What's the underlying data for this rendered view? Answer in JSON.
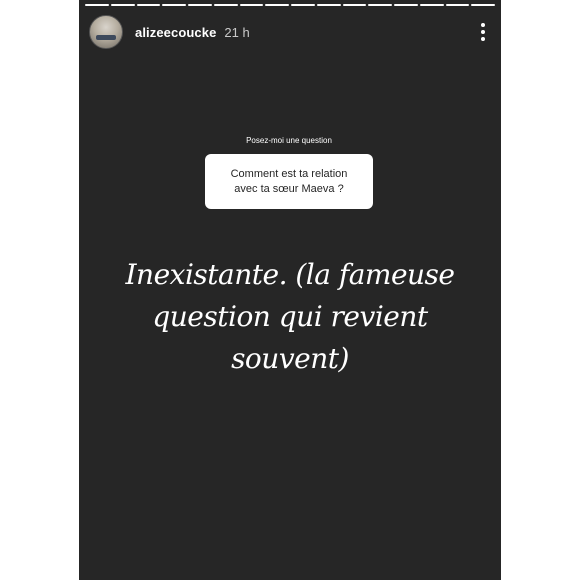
{
  "story": {
    "progress": {
      "segments": 16,
      "completed": 15
    },
    "header": {
      "username": "alizeecoucke",
      "time": "21 h",
      "avatar_icon": "avatar-photo",
      "menu_icon": "more-vertical-icon"
    },
    "question_sticker": {
      "prompt": "Posez-moi une question",
      "question_line1": "Comment est ta relation",
      "question_line2": "avec ta sœur Maeva ?"
    },
    "answer": {
      "line1": "Inexistante. (la fameuse",
      "line2": "question qui revient",
      "line3": "souvent)"
    }
  }
}
